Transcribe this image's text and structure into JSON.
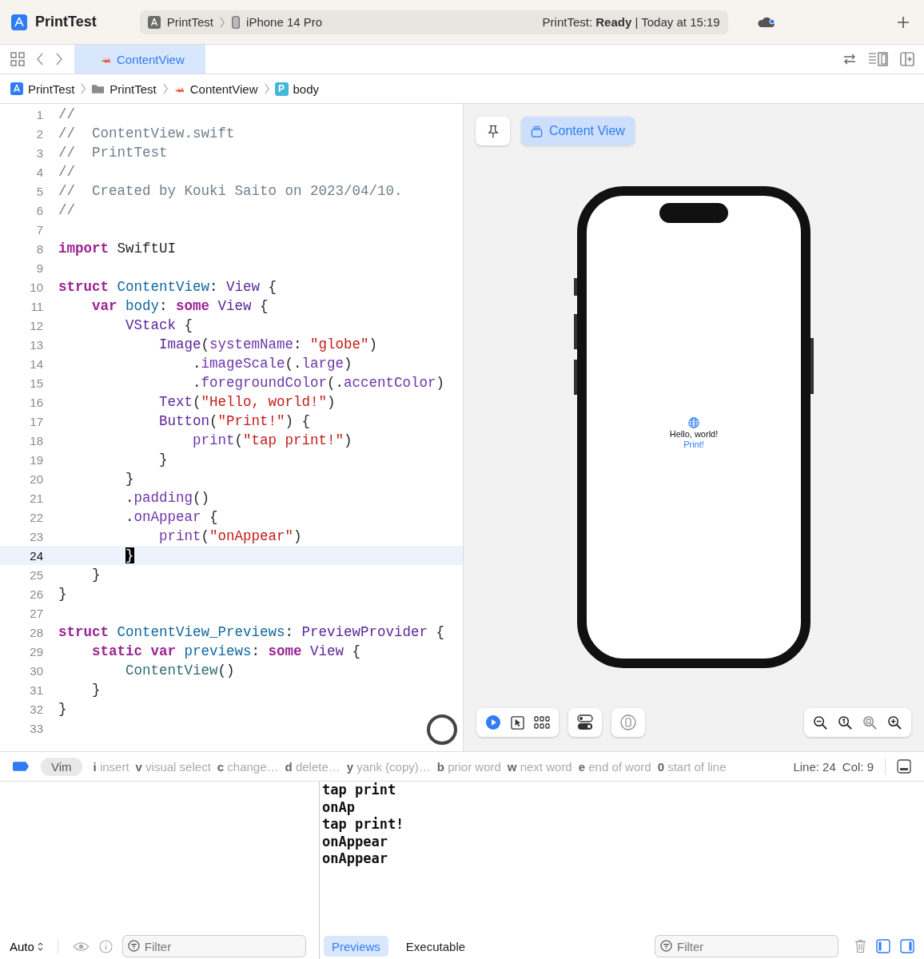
{
  "toolbar": {
    "app_name": "PrintTest",
    "scheme": "PrintTest",
    "device": "iPhone 14 Pro",
    "status": "PrintTest: **Ready** | Today at 15:19"
  },
  "tabs": [
    {
      "label": "ContentView",
      "selected": true
    }
  ],
  "breadcrumb": [
    {
      "kind": "project",
      "label": "PrintTest"
    },
    {
      "kind": "folder",
      "label": "PrintTest"
    },
    {
      "kind": "swift",
      "label": "ContentView"
    },
    {
      "kind": "property",
      "badge": "P",
      "label": "body"
    }
  ],
  "editor": {
    "lines": [
      {
        "number": "1",
        "current": false,
        "tokens": [
          {
            "kind": "comment",
            "text": "//"
          }
        ]
      },
      {
        "number": "2",
        "current": false,
        "tokens": [
          {
            "kind": "comment",
            "text": "//  ContentView.swift"
          }
        ]
      },
      {
        "number": "3",
        "current": false,
        "tokens": [
          {
            "kind": "comment",
            "text": "//  PrintTest"
          }
        ]
      },
      {
        "number": "4",
        "current": false,
        "tokens": [
          {
            "kind": "comment",
            "text": "//"
          }
        ]
      },
      {
        "number": "5",
        "current": false,
        "tokens": [
          {
            "kind": "comment",
            "text": "//  Created by Kouki Saito on 2023/04/10."
          }
        ]
      },
      {
        "number": "6",
        "current": false,
        "tokens": [
          {
            "kind": "comment",
            "text": "//"
          }
        ]
      },
      {
        "number": "7",
        "current": false
      },
      {
        "number": "8",
        "current": false,
        "tokens": [
          {
            "kind": "keyword",
            "text": "import"
          },
          {
            "kind": "plain",
            "text": " SwiftUI"
          }
        ]
      },
      {
        "number": "9",
        "current": false
      },
      {
        "number": "10",
        "current": false,
        "tokens": [
          {
            "kind": "keyword",
            "text": "struct"
          },
          {
            "kind": "decl",
            "text": " ContentView"
          },
          {
            "kind": "plain",
            "text": ": "
          },
          {
            "kind": "type",
            "text": "View"
          },
          {
            "kind": "plain",
            "text": " {"
          }
        ]
      },
      {
        "number": "11",
        "current": false,
        "tokens": [
          {
            "kind": "keyword",
            "text": "    var"
          },
          {
            "kind": "decl",
            "text": " body"
          },
          {
            "kind": "plain",
            "text": ": "
          },
          {
            "kind": "keyword",
            "text": "some"
          },
          {
            "kind": "type",
            "text": " View"
          },
          {
            "kind": "plain",
            "text": " {"
          }
        ]
      },
      {
        "number": "12",
        "current": false,
        "tokens": [
          {
            "kind": "type",
            "text": "        VStack"
          },
          {
            "kind": "plain",
            "text": " {"
          }
        ]
      },
      {
        "number": "13",
        "current": false,
        "tokens": [
          {
            "kind": "type",
            "text": "            Image"
          },
          {
            "kind": "plain",
            "text": "("
          },
          {
            "kind": "call",
            "text": "systemName"
          },
          {
            "kind": "plain",
            "text": ": "
          },
          {
            "kind": "string",
            "text": "\"globe\""
          },
          {
            "kind": "plain",
            "text": ")"
          }
        ]
      },
      {
        "number": "14",
        "current": false,
        "tokens": [
          {
            "kind": "plain",
            "text": "                ."
          },
          {
            "kind": "call",
            "text": "imageScale"
          },
          {
            "kind": "plain",
            "text": "(."
          },
          {
            "kind": "call",
            "text": "large"
          },
          {
            "kind": "plain",
            "text": ")"
          }
        ]
      },
      {
        "number": "15",
        "current": false,
        "tokens": [
          {
            "kind": "plain",
            "text": "                ."
          },
          {
            "kind": "call",
            "text": "foregroundColor"
          },
          {
            "kind": "plain",
            "text": "(."
          },
          {
            "kind": "call",
            "text": "accentColor"
          },
          {
            "kind": "plain",
            "text": ")"
          }
        ]
      },
      {
        "number": "16",
        "current": false,
        "tokens": [
          {
            "kind": "type",
            "text": "            Text"
          },
          {
            "kind": "plain",
            "text": "("
          },
          {
            "kind": "string",
            "text": "\"Hello, world!\""
          },
          {
            "kind": "plain",
            "text": ")"
          }
        ]
      },
      {
        "number": "17",
        "current": false,
        "tokens": [
          {
            "kind": "type",
            "text": "            Button"
          },
          {
            "kind": "plain",
            "text": "("
          },
          {
            "kind": "string",
            "text": "\"Print!\""
          },
          {
            "kind": "plain",
            "text": ") {"
          }
        ]
      },
      {
        "number": "18",
        "current": false,
        "tokens": [
          {
            "kind": "call",
            "text": "                print"
          },
          {
            "kind": "plain",
            "text": "("
          },
          {
            "kind": "string",
            "text": "\"tap print!\""
          },
          {
            "kind": "plain",
            "text": ")"
          }
        ]
      },
      {
        "number": "19",
        "current": false,
        "tokens": [
          {
            "kind": "plain",
            "text": "            }"
          }
        ]
      },
      {
        "number": "20",
        "current": false,
        "tokens": [
          {
            "kind": "plain",
            "text": "        }"
          }
        ]
      },
      {
        "number": "21",
        "current": false,
        "tokens": [
          {
            "kind": "plain",
            "text": "        ."
          },
          {
            "kind": "call",
            "text": "padding"
          },
          {
            "kind": "plain",
            "text": "()"
          }
        ]
      },
      {
        "number": "22",
        "current": false,
        "tokens": [
          {
            "kind": "plain",
            "text": "        ."
          },
          {
            "kind": "call",
            "text": "onAppear"
          },
          {
            "kind": "plain",
            "text": " {"
          }
        ]
      },
      {
        "number": "23",
        "current": false,
        "tokens": [
          {
            "kind": "call",
            "text": "            print"
          },
          {
            "kind": "plain",
            "text": "("
          },
          {
            "kind": "string",
            "text": "\"onAppear\""
          },
          {
            "kind": "plain",
            "text": ")"
          }
        ]
      },
      {
        "number": "24",
        "current": true,
        "tokens": [
          {
            "kind": "cursor",
            "text": "        }"
          }
        ]
      },
      {
        "number": "25",
        "current": false,
        "tokens": [
          {
            "kind": "plain",
            "text": "    }"
          }
        ]
      },
      {
        "number": "26",
        "current": false,
        "tokens": [
          {
            "kind": "plain",
            "text": "}"
          }
        ]
      },
      {
        "number": "27",
        "current": false
      },
      {
        "number": "28",
        "current": false,
        "tokens": [
          {
            "kind": "keyword",
            "text": "struct"
          },
          {
            "kind": "decl",
            "text": " ContentView_Previews"
          },
          {
            "kind": "plain",
            "text": ": "
          },
          {
            "kind": "type",
            "text": "PreviewProvider"
          },
          {
            "kind": "plain",
            "text": " {"
          }
        ]
      },
      {
        "number": "29",
        "current": false,
        "tokens": [
          {
            "kind": "keyword",
            "text": "    static var"
          },
          {
            "kind": "decl",
            "text": " previews"
          },
          {
            "kind": "plain",
            "text": ": "
          },
          {
            "kind": "keyword",
            "text": "some"
          },
          {
            "kind": "type",
            "text": " View"
          },
          {
            "kind": "plain",
            "text": " {"
          }
        ]
      },
      {
        "number": "30",
        "current": false,
        "tokens": [
          {
            "kind": "ref",
            "text": "        ContentView"
          },
          {
            "kind": "plain",
            "text": "()"
          }
        ]
      },
      {
        "number": "31",
        "current": false,
        "tokens": [
          {
            "kind": "plain",
            "text": "    }"
          }
        ]
      },
      {
        "number": "32",
        "current": false,
        "tokens": [
          {
            "kind": "plain",
            "text": "}"
          }
        ]
      },
      {
        "number": "33",
        "current": false
      }
    ]
  },
  "preview": {
    "chip": "Content View",
    "screen_text": "Hello, world!",
    "screen_button": "Print!"
  },
  "vim_bar": {
    "mode": "Vim",
    "hints": [
      {
        "key": "i",
        "label": "insert"
      },
      {
        "key": "v",
        "label": "visual select"
      },
      {
        "key": "c",
        "label": "change…"
      },
      {
        "key": "d",
        "label": "delete…"
      },
      {
        "key": "y",
        "label": "yank (copy)…"
      },
      {
        "key": "b",
        "label": "prior word"
      },
      {
        "key": "w",
        "label": "next word"
      },
      {
        "key": "e",
        "label": "end of word"
      },
      {
        "key": "0",
        "label": "start of line"
      }
    ],
    "line": "Line: 24",
    "col": "Col: 9"
  },
  "variables": {
    "mode": "Auto",
    "filter_placeholder": "Filter"
  },
  "console": {
    "lines": [
      "tap print",
      "onAp",
      "tap print!",
      "onAppear",
      "onAppear"
    ],
    "tabs": [
      {
        "label": "Previews",
        "selected": true
      },
      {
        "label": "Executable",
        "selected": false
      }
    ],
    "filter_placeholder": "Filter"
  }
}
